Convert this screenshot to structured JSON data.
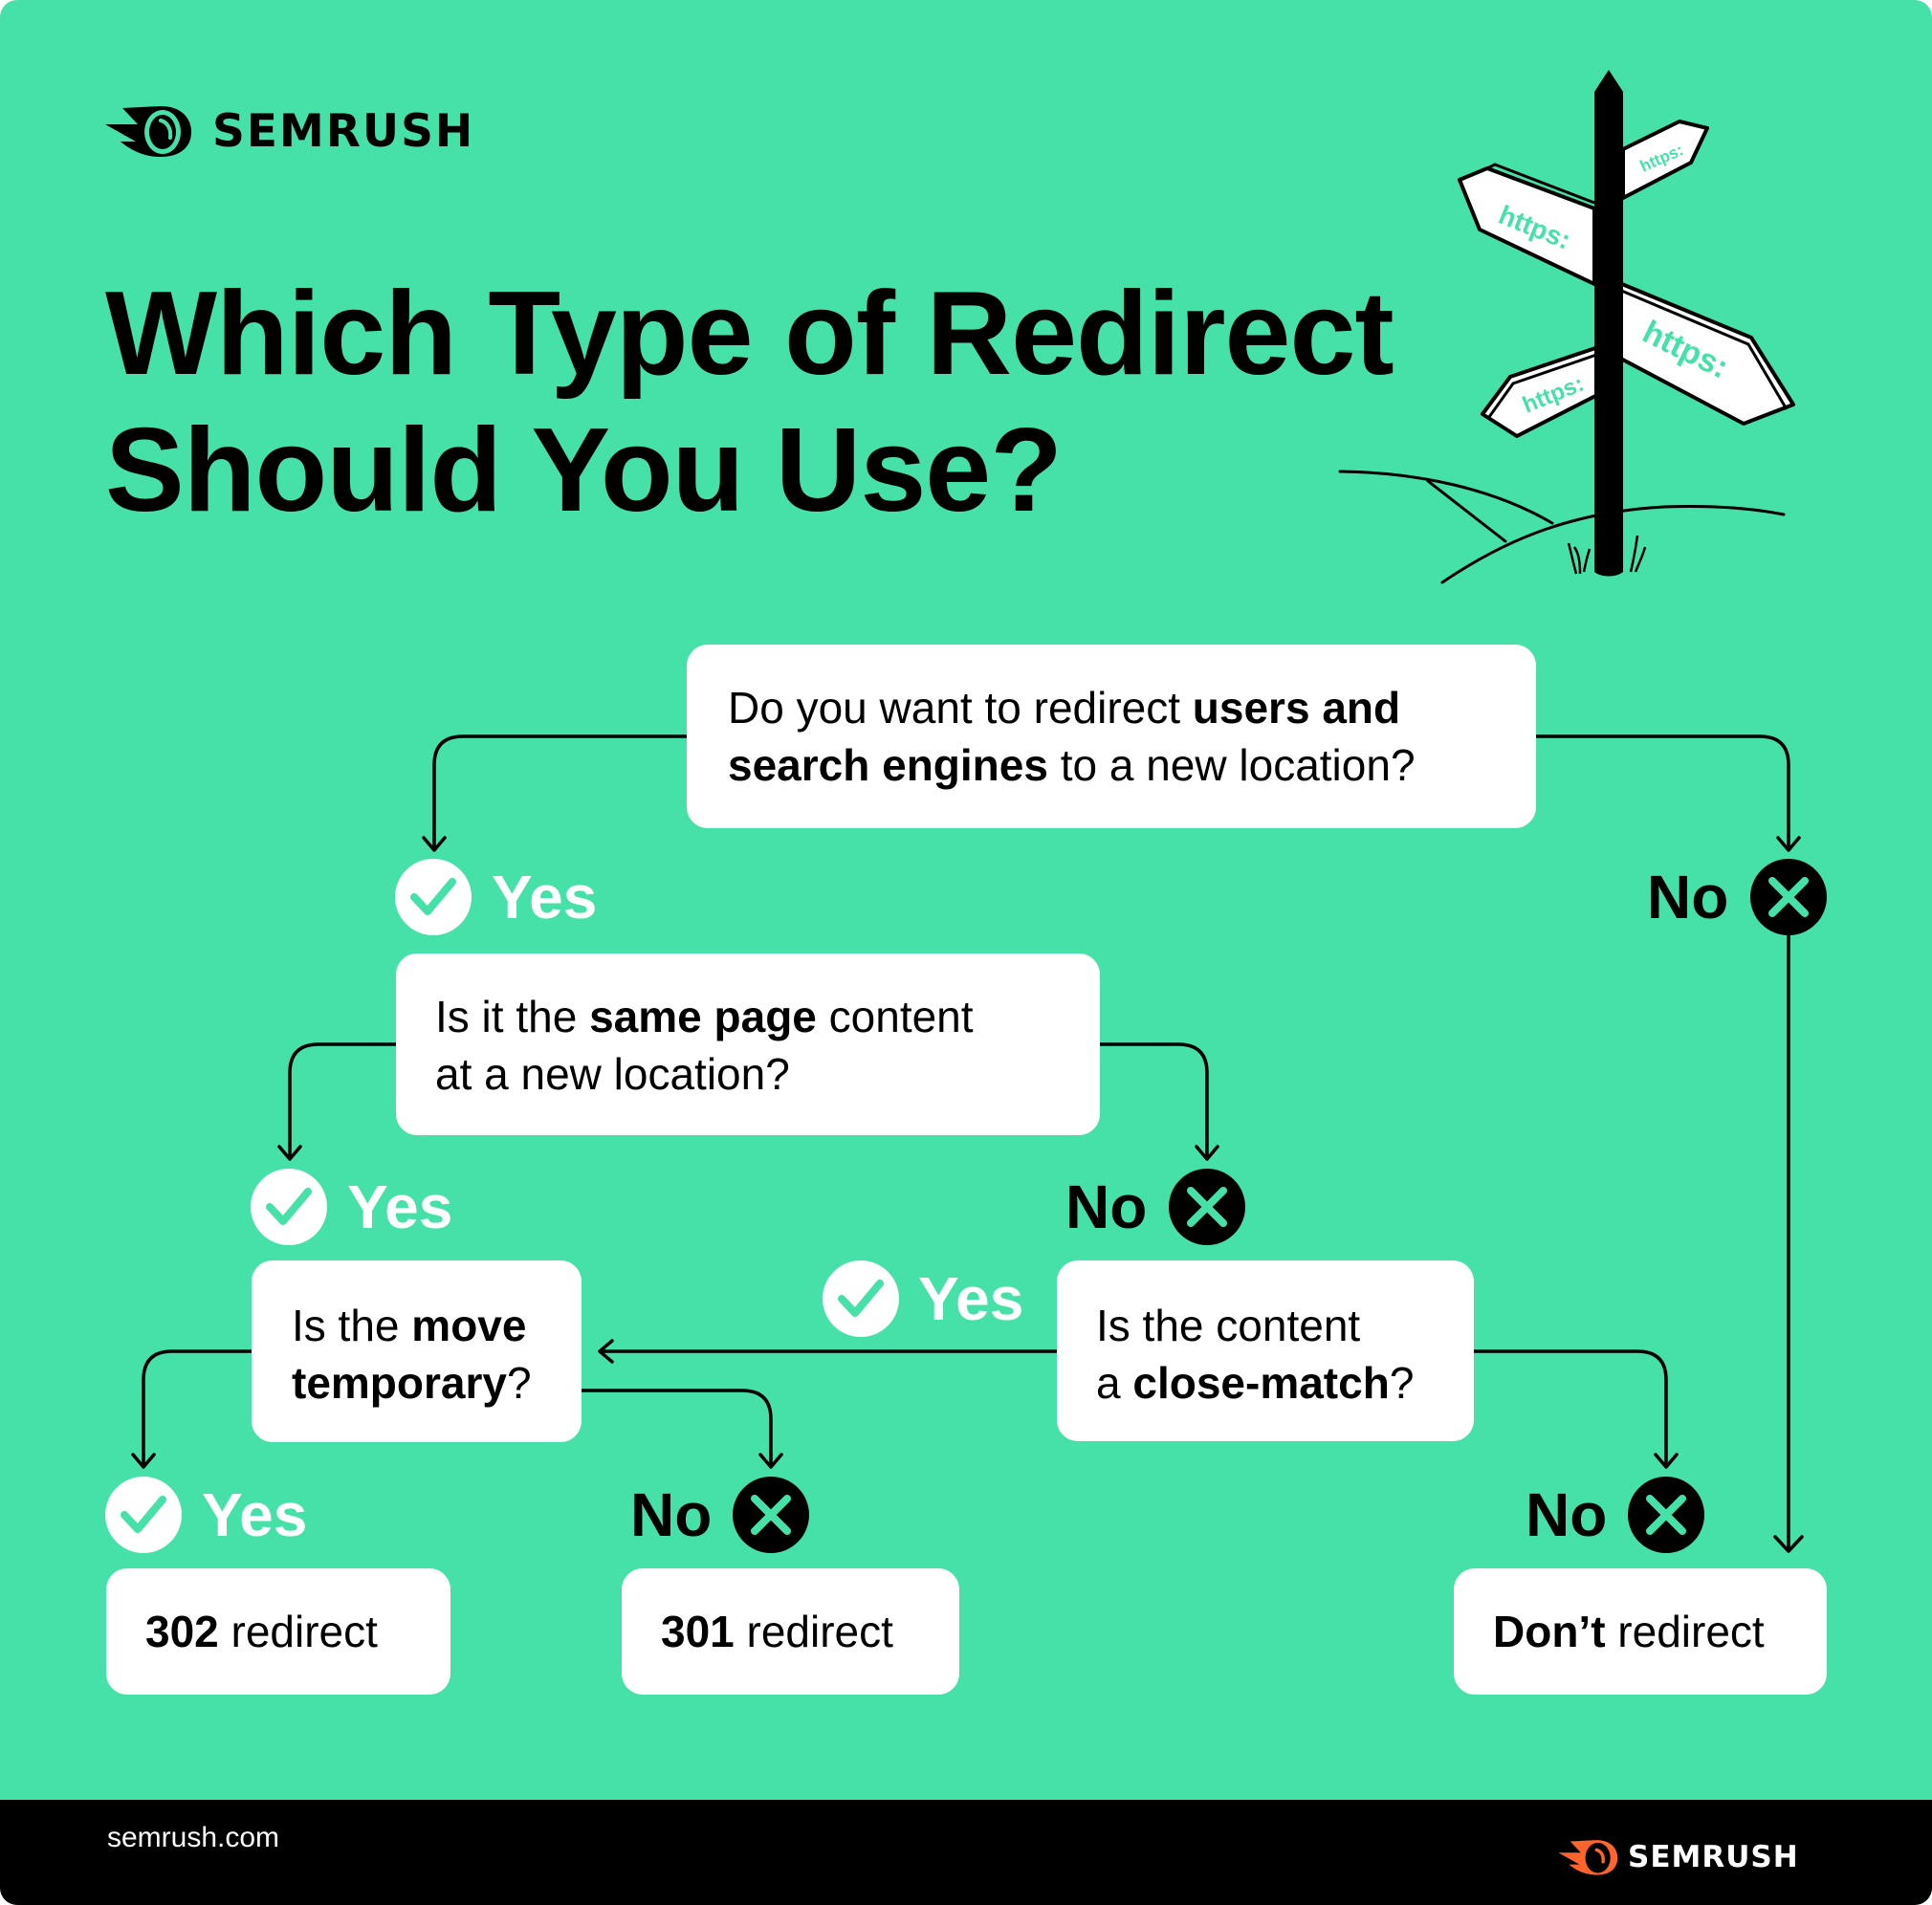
{
  "colors": {
    "background": "#46E1A8",
    "box": "#FFFFFF",
    "ink": "#000000",
    "yes_text": "#FFFFFF",
    "footer_bg": "#000000",
    "brand_orange": "#FF642D",
    "sign_text": "#46E1A8"
  },
  "header": {
    "logo_icon": "semrush-fireball-icon",
    "logo_text": "SEMRUSH",
    "title_line1": "Which Type of Redirect",
    "title_line2": "Should You Use?"
  },
  "illustration": {
    "icon": "signpost-icon",
    "signs": [
      "https:",
      "https:",
      "https:",
      "https:"
    ]
  },
  "flowchart": {
    "q1": {
      "parts": [
        {
          "text": "Do you want to redirect ",
          "bold": false
        },
        {
          "text": "users and",
          "bold": true
        },
        {
          "text": "search engines",
          "bold": true
        },
        {
          "text": " to a new location?",
          "bold": false
        }
      ]
    },
    "q1_yes": {
      "label": "Yes",
      "icon": "check-circle-icon"
    },
    "q1_no": {
      "label": "No",
      "icon": "x-circle-icon"
    },
    "q2": {
      "parts": [
        {
          "text": "Is it the ",
          "bold": false
        },
        {
          "text": "same page",
          "bold": true
        },
        {
          "text": " content",
          "bold": false
        },
        {
          "text": "at a new location?",
          "bold": false
        }
      ]
    },
    "q2_yes": {
      "label": "Yes",
      "icon": "check-circle-icon"
    },
    "q2_no": {
      "label": "No",
      "icon": "x-circle-icon"
    },
    "q3": {
      "parts": [
        {
          "text": "Is the ",
          "bold": false
        },
        {
          "text": "move",
          "bold": true
        },
        {
          "text": "temporary",
          "bold": true
        },
        {
          "text": "?",
          "bold": false
        }
      ]
    },
    "q3_yes": {
      "label": "Yes",
      "icon": "check-circle-icon"
    },
    "q3_no": {
      "label": "No",
      "icon": "x-circle-icon"
    },
    "q4": {
      "parts": [
        {
          "text": "Is the content",
          "bold": false
        },
        {
          "text": "a ",
          "bold": false
        },
        {
          "text": "close-match",
          "bold": true
        },
        {
          "text": "?",
          "bold": false
        }
      ]
    },
    "q4_yes": {
      "label": "Yes",
      "icon": "check-circle-icon"
    },
    "q4_no": {
      "label": "No",
      "icon": "x-circle-icon"
    },
    "results": [
      {
        "bold": "302",
        "rest": " redirect"
      },
      {
        "bold": "301",
        "rest": " redirect"
      },
      {
        "bold": "Don’t",
        "rest": " redirect"
      }
    ]
  },
  "footer": {
    "url": "semrush.com",
    "logo_icon": "semrush-fireball-icon",
    "logo_text": "SEMRUSH"
  }
}
